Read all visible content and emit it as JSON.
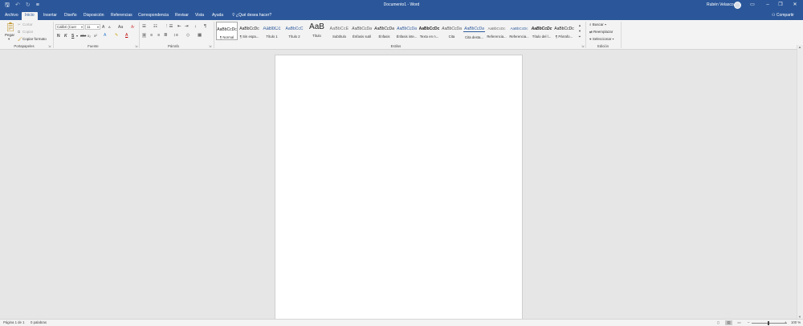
{
  "window": {
    "title": "Documento1  -  Word",
    "user": "Rubén Velasco",
    "share_label": "Compartir"
  },
  "tabs": [
    {
      "label": "Archivo"
    },
    {
      "label": "Inicio"
    },
    {
      "label": "Insertar"
    },
    {
      "label": "Diseño"
    },
    {
      "label": "Disposición"
    },
    {
      "label": "Referencias"
    },
    {
      "label": "Correspondencia"
    },
    {
      "label": "Revisar"
    },
    {
      "label": "Vista"
    },
    {
      "label": "Ayuda"
    }
  ],
  "tell_me": "¿Qué desea hacer?",
  "clipboard": {
    "label": "Portapapeles",
    "paste": "Pegar",
    "cut": "Cortar",
    "copy": "Copiar",
    "format_painter": "Copiar formato"
  },
  "font": {
    "label": "Fuente",
    "family": "Calibri (Cuer",
    "size": "11",
    "bold": "N",
    "italic": "K",
    "underline": "S",
    "strike": "abc",
    "subscript": "x₂",
    "superscript": "x²",
    "case": "Aa",
    "grow": "A",
    "shrink": "A"
  },
  "paragraph": {
    "label": "Párrafo"
  },
  "styles": {
    "label": "Estilos",
    "items": [
      {
        "preview": "AaBbCcDc",
        "name": "¶ Normal"
      },
      {
        "preview": "AaBbCcDc",
        "name": "¶ Sin espa..."
      },
      {
        "preview": "AaBbCc",
        "name": "Título 1"
      },
      {
        "preview": "AaBbCcC",
        "name": "Título 2"
      },
      {
        "preview": "AaB",
        "name": "Título"
      },
      {
        "preview": "AaBbCcE",
        "name": "Subtítulo"
      },
      {
        "preview": "AaBbCcDa",
        "name": "Énfasis sutil"
      },
      {
        "preview": "AaBbCcDa",
        "name": "Énfasis"
      },
      {
        "preview": "AaBbCcDa",
        "name": "Énfasis inte..."
      },
      {
        "preview": "AaBbCcDc",
        "name": "Texto en n..."
      },
      {
        "preview": "AaBbCcDa",
        "name": "Cita"
      },
      {
        "preview": "AaBbCcDa",
        "name": "Cita desta..."
      },
      {
        "preview": "AaBbCcDc",
        "name": "Referencia..."
      },
      {
        "preview": "AaBbCcDc",
        "name": "Referencia..."
      },
      {
        "preview": "AaBbCcDc",
        "name": "Título del l..."
      },
      {
        "preview": "AaBbCcDc",
        "name": "¶ Párrafo..."
      }
    ]
  },
  "editing": {
    "label": "Edición",
    "find": "Buscar",
    "replace": "Reemplazar",
    "select": "Seleccionar"
  },
  "status": {
    "page": "Página 1 de 1",
    "words": "0 palabras",
    "zoom": "100 %"
  },
  "colors": {
    "brand": "#2b579a",
    "ribbon": "#f3f3f3",
    "workspace": "#e6e6e6"
  }
}
